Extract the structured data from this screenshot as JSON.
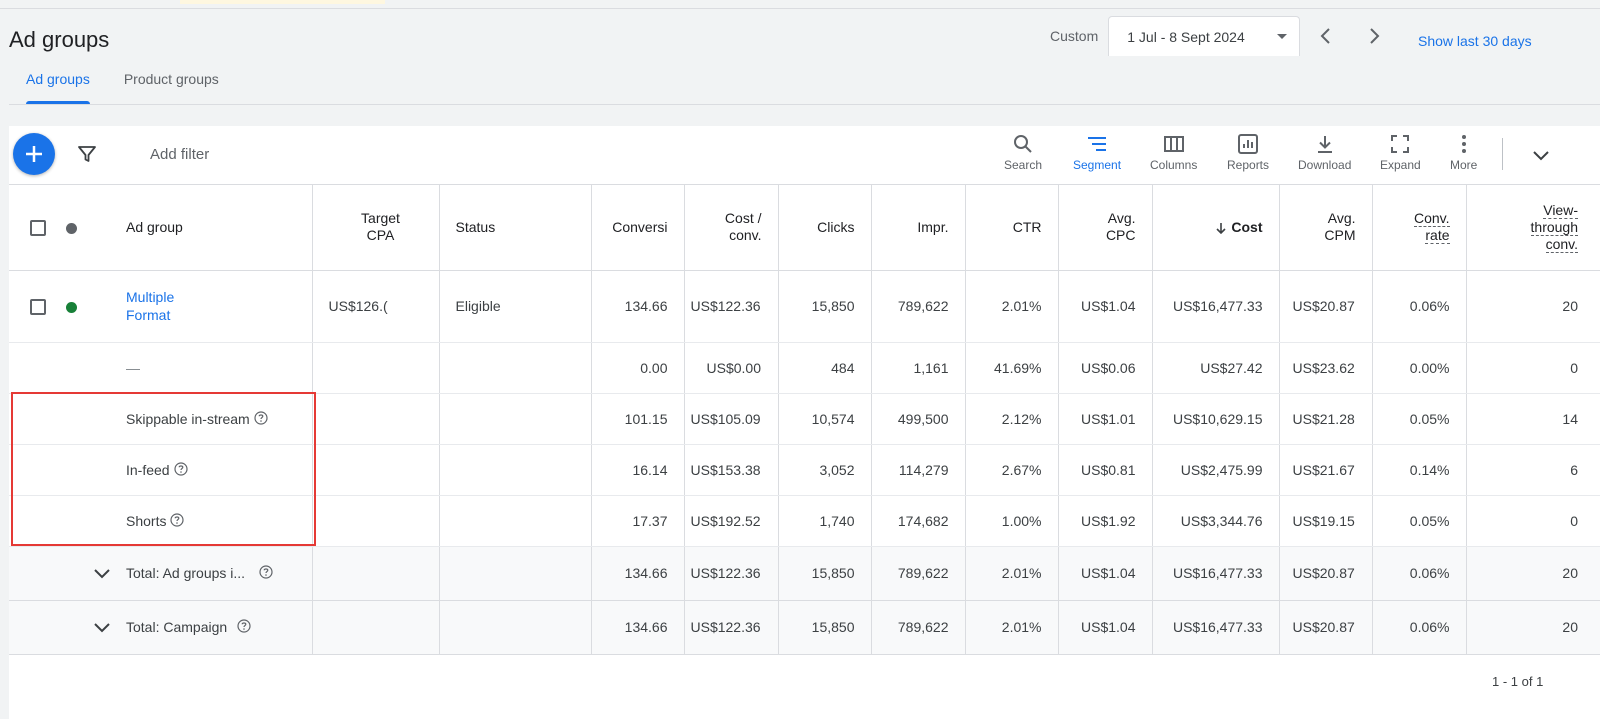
{
  "page": {
    "title": "Ad groups",
    "custom_label": "Custom",
    "date_range": "1 Jul - 8 Sept 2024",
    "show_last": "Show last 30 days"
  },
  "tabs": [
    {
      "label": "Ad groups",
      "active": true
    },
    {
      "label": "Product groups",
      "active": false
    }
  ],
  "toolbar": {
    "add_filter": "Add filter",
    "tools": [
      {
        "label": "Search",
        "icon": "search-icon"
      },
      {
        "label": "Segment",
        "icon": "segment-icon",
        "active": true
      },
      {
        "label": "Columns",
        "icon": "columns-icon"
      },
      {
        "label": "Reports",
        "icon": "reports-icon"
      },
      {
        "label": "Download",
        "icon": "download-icon"
      },
      {
        "label": "Expand",
        "icon": "expand-icon"
      },
      {
        "label": "More",
        "icon": "more-vert-icon"
      }
    ]
  },
  "table": {
    "headers": {
      "ad_group": "Ad group",
      "target_cpa_1": "Target",
      "target_cpa_2": "CPA",
      "status": "Status",
      "conversions": "Conversi",
      "cost_conv_1": "Cost /",
      "cost_conv_2": "conv.",
      "clicks": "Clicks",
      "impr": "Impr.",
      "ctr": "CTR",
      "avg_cpc_1": "Avg.",
      "avg_cpc_2": "CPC",
      "cost": "Cost",
      "avg_cpm_1": "Avg.",
      "avg_cpm_2": "CPM",
      "conv_rate_1": "Conv.",
      "conv_rate_2": "rate",
      "view_conv_1": "View-",
      "view_conv_2": "through",
      "view_conv_3": "conv."
    },
    "main_row": {
      "name_line1": "Multiple",
      "name_line2": "Format",
      "target_cpa": "US$126.(",
      "status": "Eligible",
      "status_color": "#188038",
      "values": [
        "134.66",
        "US$122.36",
        "15,850",
        "789,622",
        "2.01%",
        "US$1.04",
        "US$16,477.33",
        "US$20.87",
        "0.06%",
        "20"
      ]
    },
    "segments": [
      {
        "label": "—",
        "help": false,
        "values": [
          "0.00",
          "US$0.00",
          "484",
          "1,161",
          "41.69%",
          "US$0.06",
          "US$27.42",
          "US$23.62",
          "0.00%",
          "0"
        ]
      },
      {
        "label": "Skippable in-stream",
        "help": true,
        "values": [
          "101.15",
          "US$105.09",
          "10,574",
          "499,500",
          "2.12%",
          "US$1.01",
          "US$10,629.15",
          "US$21.28",
          "0.05%",
          "14"
        ]
      },
      {
        "label": "In-feed",
        "help": true,
        "values": [
          "16.14",
          "US$153.38",
          "3,052",
          "114,279",
          "2.67%",
          "US$0.81",
          "US$2,475.99",
          "US$21.67",
          "0.14%",
          "6"
        ]
      },
      {
        "label": "Shorts",
        "help": true,
        "values": [
          "17.37",
          "US$192.52",
          "1,740",
          "174,682",
          "1.00%",
          "US$1.92",
          "US$3,344.76",
          "US$19.15",
          "0.05%",
          "0"
        ]
      }
    ],
    "totals": [
      {
        "label": "Total: Ad groups i...",
        "values": [
          "134.66",
          "US$122.36",
          "15,850",
          "789,622",
          "2.01%",
          "US$1.04",
          "US$16,477.33",
          "US$20.87",
          "0.06%",
          "20"
        ]
      },
      {
        "label": "Total: Campaign",
        "values": [
          "134.66",
          "US$122.36",
          "15,850",
          "789,622",
          "2.01%",
          "US$1.04",
          "US$16,477.33",
          "US$20.87",
          "0.06%",
          "20"
        ]
      }
    ]
  },
  "pagination": "1 - 1 of 1",
  "colors": {
    "accent": "#1a73e8",
    "highlight_box": "#e53935"
  }
}
